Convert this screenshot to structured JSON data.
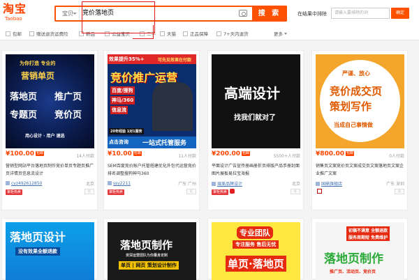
{
  "header": {
    "logo_cn": "淘宝",
    "logo_en": "Taobao",
    "search_type": "宝贝",
    "search_query": "竞价落地页",
    "search_button": "搜 索",
    "in_result_label": "在结果中排除",
    "in_result_placeholder": "请输入要排除的词",
    "confirm_button": "确定"
  },
  "filters": [
    {
      "label": "包邮"
    },
    {
      "label": "赠送退货运费险"
    },
    {
      "label": "新品"
    },
    {
      "label": "公益宝贝"
    },
    {
      "label": "二手"
    },
    {
      "label": "天猫"
    },
    {
      "label": "正品保障"
    },
    {
      "label": "7+天内退货"
    }
  ],
  "more_label": "更多",
  "products": [
    {
      "image": {
        "lines": [
          "为你打造 专业的",
          "营销单页",
          "落地页",
          "推广页",
          "专题页",
          "竞价页",
          "用心设计 · 用心设计",
          "用心设计 · 用户 速选"
        ]
      },
      "price": "¥100.00",
      "baoyou": "包邮",
      "sold": "14人付款",
      "title_hl": "",
      "title": "营销型网站平台落地页制作竞价单页专题页推广页详情页信息流设计",
      "shop": "cyz492612850",
      "location": "北京",
      "badge": "掌柜热卖"
    },
    {
      "image": {
        "top": "效果提升35%+",
        "top2": "可先见效果在付款",
        "main": "竞价推广运营",
        "tags": [
          "百度/搜狗",
          "神马/360",
          "信息流"
        ],
        "years": "20年经验 1对1服务",
        "cta": "点击咨询",
        "service": "一站式托管服务"
      },
      "price": "¥10.00",
      "baoyou": "包邮",
      "sold": "11人付款",
      "title": "SEM百度竞价账户托管搭建优化外包代运营竞价排名调整搜狗神马360",
      "shop": "ssy2211",
      "location": "广东 广州",
      "badge": "掌柜热卖"
    },
    {
      "image": {
        "main": "高端设计",
        "sub": "找我们就对了"
      },
      "price": "¥200.00",
      "baoyou": "包邮",
      "sold": "5500+人付款",
      "title": "平面设计广告宣传册画册折页排版产品手册封面图片展板易拉宝海报",
      "shop": "璃美品牌设计",
      "location": "北京",
      "badge": "掌柜热卖"
    },
    {
      "image": {
        "top": "严谨、放心",
        "l1": "竞价成交页",
        "l2": "策划写作",
        "l3": "当成自己事情做"
      },
      "price": "¥800.00",
      "baoyou": "包邮",
      "sold": "0人付款",
      "title": "销售页文案竞价页文案成交页文案落地页文案企业推广文案",
      "shop": "国鼎旗舰店",
      "location": "广东 深圳",
      "badge": ""
    },
    {
      "image": {
        "main": "落地页设计",
        "sub": "没有效果全额退款"
      }
    },
    {
      "image": {
        "main": "落地页制作",
        "sub": "资深运营团队为你量身定制",
        "tags": "单页 | 网页 策划设计制作"
      }
    },
    {
      "image": {
        "badge": "专业团队",
        "sub": "专注服务 售后无忧",
        "main": "单页·落地页"
      }
    },
    {
      "image": {
        "top": "初稿不满意 全额退款",
        "top2": "服务周期短 免费维护",
        "main": "落地页制作",
        "foot": "推广页、活动页、竞价页"
      }
    }
  ]
}
